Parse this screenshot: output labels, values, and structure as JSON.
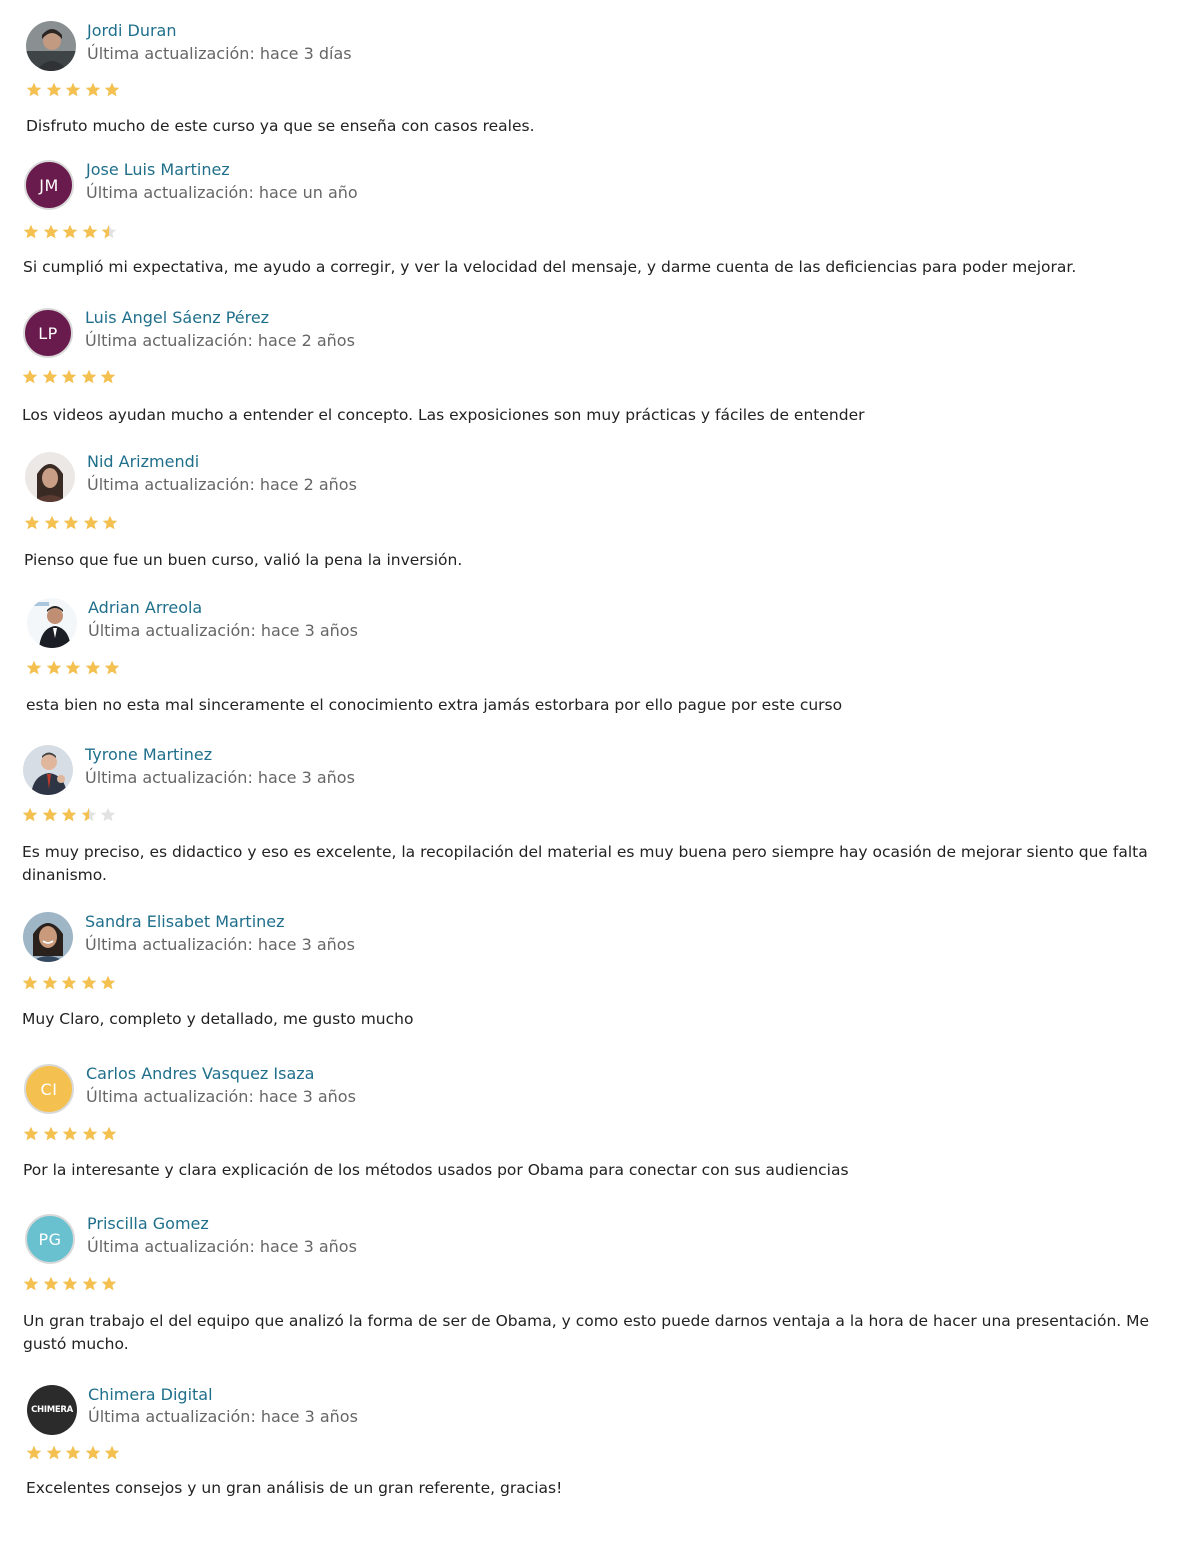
{
  "colors": {
    "name_link": "#1f6f8b",
    "star_filled": "#f4c150",
    "star_empty": "#e2e2e2"
  },
  "reviews": [
    {
      "name": "Jordi Duran",
      "updated": "Última actualización: hace 3 días",
      "rating": 5,
      "avatar": {
        "type": "photo",
        "icon": "user-photo-man-dark-hair"
      },
      "text": "Disfruto mucho de este curso ya que se enseña con casos reales."
    },
    {
      "name": "Jose Luis Martinez",
      "updated": "Última actualización: hace un año",
      "rating": 4.5,
      "avatar": {
        "type": "initials",
        "initials": "JM",
        "color": "#6a1b4d"
      },
      "text": "Si cumplió mi expectativa, me ayudo a corregir, y ver la velocidad del mensaje, y darme cuenta de las deficiencias para poder mejorar."
    },
    {
      "name": "Luis Angel Sáenz Pérez",
      "updated": "Última actualización: hace 2 años",
      "rating": 5,
      "avatar": {
        "type": "initials",
        "initials": "LP",
        "color": "#6a1b4d"
      },
      "text": "Los videos ayudan mucho a entender el concepto. Las exposiciones son muy prácticas y fáciles de entender"
    },
    {
      "name": "Nid Arizmendi",
      "updated": "Última actualización: hace 2 años",
      "rating": 5,
      "avatar": {
        "type": "photo",
        "icon": "user-photo-woman"
      },
      "text": "Pienso que fue un buen curso, valió la pena la inversión."
    },
    {
      "name": "Adrian Arreola",
      "updated": "Última actualización: hace 3 años",
      "rating": 5,
      "avatar": {
        "type": "photo",
        "icon": "user-photo-man-suit"
      },
      "text": "esta bien no esta mal sinceramente el conocimiento extra jamás estorbara por ello pague por este curso"
    },
    {
      "name": "Tyrone Martinez",
      "updated": "Última actualización: hace 3 años",
      "rating": 3.5,
      "avatar": {
        "type": "photo",
        "icon": "user-photo-man-speaking"
      },
      "text": "Es muy preciso, es didactico y eso es excelente, la recopilación del material es muy buena pero siempre hay ocasión de mejorar siento que falta dinanismo."
    },
    {
      "name": "Sandra Elisabet Martinez",
      "updated": "Última actualización: hace 3 años",
      "rating": 5,
      "avatar": {
        "type": "photo",
        "icon": "user-photo-woman-smiling"
      },
      "text": "Muy Claro, completo y detallado, me gusto mucho"
    },
    {
      "name": "Carlos Andres Vasquez Isaza",
      "updated": "Última actualización: hace 3 años",
      "rating": 5,
      "avatar": {
        "type": "initials",
        "initials": "CI",
        "color": "#f4c150"
      },
      "text": "Por la interesante y clara explicación de los métodos usados por Obama para conectar con sus audiencias"
    },
    {
      "name": "Priscilla Gomez",
      "updated": "Última actualización: hace 3 años",
      "rating": 5,
      "avatar": {
        "type": "initials",
        "initials": "PG",
        "color": "#69c1d0"
      },
      "text": "Un gran trabajo el del equipo que analizó la forma de ser de Obama, y como esto puede darnos ventaja a la hora de hacer una presentación. Me gustó mucho."
    },
    {
      "name": "Chimera Digital",
      "updated": "Última actualización: hace 3 años",
      "rating": 5,
      "avatar": {
        "type": "logo",
        "icon": "chimera-logo",
        "logo_text": "CHIMERA"
      },
      "text": "Excelentes consejos y un gran análisis de un gran referente, gracias!"
    }
  ]
}
